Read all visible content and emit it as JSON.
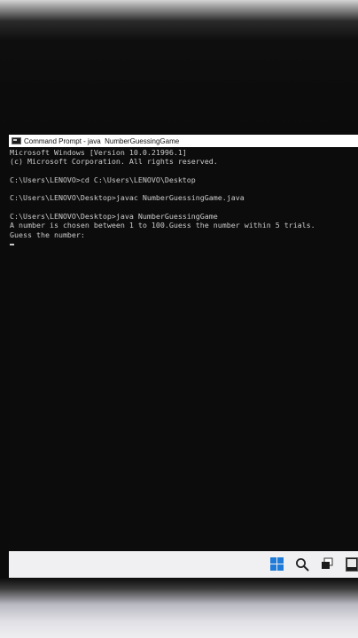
{
  "window": {
    "title": "Command Prompt - java  NumberGuessingGame",
    "icon": "cmd-icon"
  },
  "console": {
    "lines": [
      "Microsoft Windows [Version 10.0.21996.1]",
      "(c) Microsoft Corporation. All rights reserved.",
      "",
      "C:\\Users\\LENOVO>cd C:\\Users\\LENOVO\\Desktop",
      "",
      "C:\\Users\\LENOVO\\Desktop>javac NumberGuessingGame.java",
      "",
      "C:\\Users\\LENOVO\\Desktop>java NumberGuessingGame",
      "A number is chosen between 1 to 100.Guess the number within 5 trials.",
      "Guess the number:"
    ]
  },
  "taskbar": {
    "icons": [
      "windows-start-icon",
      "search-icon",
      "task-view-icon",
      "terminal-icon"
    ],
    "accent_color": "#1f7bd8"
  }
}
